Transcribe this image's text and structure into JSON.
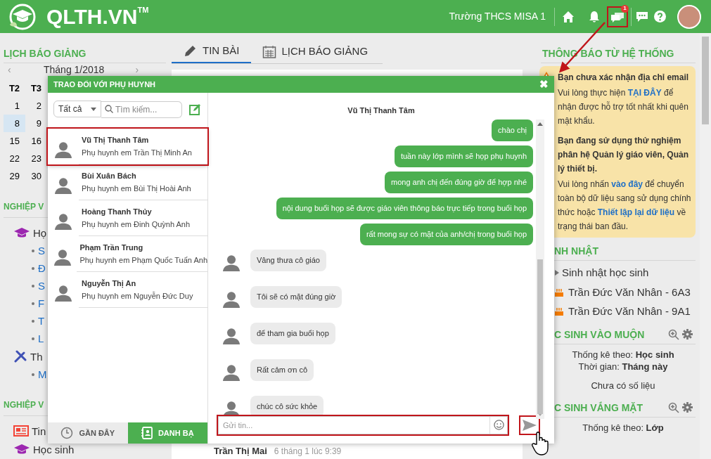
{
  "header": {
    "logo": "QLTH.VN",
    "logo_mark": "TM",
    "school": "Trường THCS MISA 1",
    "chat_badge": "1",
    "chat_highlighted": true
  },
  "left_sidebar": {
    "title": "LỊCH BÁO GIẢNG",
    "prev": "‹",
    "month": "Tháng 1/2018",
    "next": "›",
    "weekdays": [
      "T2",
      "T3"
    ],
    "days": [
      {
        "day": "1",
        "selected": false
      },
      {
        "day": "2",
        "selected": false
      },
      {
        "day": "8",
        "selected": true
      },
      {
        "day": "9",
        "selected": false
      },
      {
        "day": "15",
        "selected": false
      },
      {
        "day": "16",
        "selected": false
      },
      {
        "day": "22",
        "selected": false
      },
      {
        "day": "23",
        "selected": false
      },
      {
        "day": "29",
        "selected": false
      },
      {
        "day": "30",
        "selected": false
      }
    ],
    "sections": [
      {
        "title": "NGHIỆP V",
        "groups": [
          {
            "label": "Họ",
            "children": [
              {
                "label": "S"
              },
              {
                "label": "Đ"
              },
              {
                "label": "S"
              },
              {
                "label": "F"
              },
              {
                "label": "T"
              },
              {
                "label": "L"
              }
            ]
          },
          {
            "label": "Th",
            "children": [
              {
                "label": "M"
              }
            ]
          }
        ]
      },
      {
        "title": "NGHIỆP V",
        "groups": [
          {
            "label": "Tin"
          },
          {
            "label": "Học sinh"
          }
        ]
      }
    ]
  },
  "main": {
    "tabs": [
      {
        "label": "TIN BÀI",
        "selected": true
      },
      {
        "label": "LỊCH BÁO GIẢNG",
        "selected": false
      }
    ],
    "post": {
      "author": "Trần Thị Mai",
      "time": "6 tháng 1 lúc 9:39"
    }
  },
  "right_panel": {
    "title": "THÔNG BÁO TỪ HỆ THỐNG",
    "notices": [
      {
        "heading": "Bạn chưa xác nhận địa chỉ email",
        "body": [
          {
            "text": "Vui lòng thực hiện "
          },
          {
            "link": "TẠI ĐÂY"
          },
          {
            "text": " để nhận được hỗ trợ tốt nhất khi quên mật khẩu."
          }
        ]
      },
      {
        "heading": "Bạn đang sử dụng thử nghiệm phân hệ Quản lý giáo viên, Quản lý thiết bị.",
        "body": [
          {
            "text": "Vui lòng nhấn "
          },
          {
            "link": "vào đây"
          },
          {
            "text": " để chuyển toàn bộ dữ liệu sang sử dụng chính thức hoặc "
          },
          {
            "link": "Thiết lập lại dữ liệu"
          },
          {
            "text": " về trạng thái ban đầu."
          }
        ]
      }
    ],
    "birthday": {
      "title": "NH NHẬT",
      "subtitle": "Sinh nhật học sinh",
      "items": [
        "Trần Đức Văn Nhân - 6A3",
        "Trần Đức Văn Nhân - 9A1"
      ]
    },
    "late": {
      "title": "C SINH VÀO MUỘN",
      "lines": [
        "Thống kê theo: **Học sinh**",
        "Thời gian: **Tháng này**"
      ],
      "empty": "Chưa có số liệu"
    },
    "absent": {
      "title": "C SINH VẮNG MẶT",
      "lines": [
        "Thống kê theo: **Lớp**"
      ]
    }
  },
  "chat": {
    "title": "TRAO ĐỔI VỚI PHỤ HUYNH",
    "close": "✖",
    "filter": "Tất cả",
    "search_placeholder": "Tìm kiếm...",
    "contacts": [
      {
        "name": "Vũ Thị Thanh Tâm",
        "subtitle": "Phụ huynh em Trần Thị Minh An",
        "highlighted": true
      },
      {
        "name": "Bùi Xuân Bách",
        "subtitle": "Phụ huynh em Bùi Thị Hoài Anh",
        "highlighted": false
      },
      {
        "name": "Hoàng Thanh Thủy",
        "subtitle": "Phụ huynh em Đinh Quỳnh Anh",
        "highlighted": false
      },
      {
        "name": "Phạm Trần Trung",
        "subtitle": "Phụ huynh em Phạm Quốc Tuấn Anh",
        "highlighted": false
      },
      {
        "name": "Nguyễn Thị An",
        "subtitle": "Phụ huynh em Nguyễn Đức Duy",
        "highlighted": false
      }
    ],
    "bottom_tabs": [
      {
        "label": "GẦN ĐÂY",
        "selected": false
      },
      {
        "label": "DANH BẠ",
        "selected": true
      }
    ],
    "conversation_title": "Vũ Thị Thanh Tâm",
    "messages": [
      {
        "kind": "sent",
        "text": "chào chị"
      },
      {
        "kind": "sent",
        "text": "tuần này lớp mình sẽ họp phụ huynh"
      },
      {
        "kind": "sent",
        "text": "mong anh chị đến đúng giờ để hợp nhé"
      },
      {
        "kind": "sent",
        "text": "nội dung buổi họp sẽ được giáo viên thông báo trực tiếp trong buổi họp"
      },
      {
        "kind": "sent",
        "text": "rất mong sự có mặt của anh/chị trong buổi họp"
      },
      {
        "kind": "received",
        "text": "Vâng thưa cô giáo"
      },
      {
        "kind": "received",
        "text": "Tôi sẽ có mặt đúng giờ"
      },
      {
        "kind": "received",
        "text": "để tham gia buổi họp"
      },
      {
        "kind": "received",
        "text": "Rất cảm ơn cô"
      },
      {
        "kind": "received",
        "text": "chúc cô sức khỏe"
      }
    ],
    "input_placeholder": "Gửi tin...",
    "input_highlighted": true,
    "send_highlighted": true
  }
}
